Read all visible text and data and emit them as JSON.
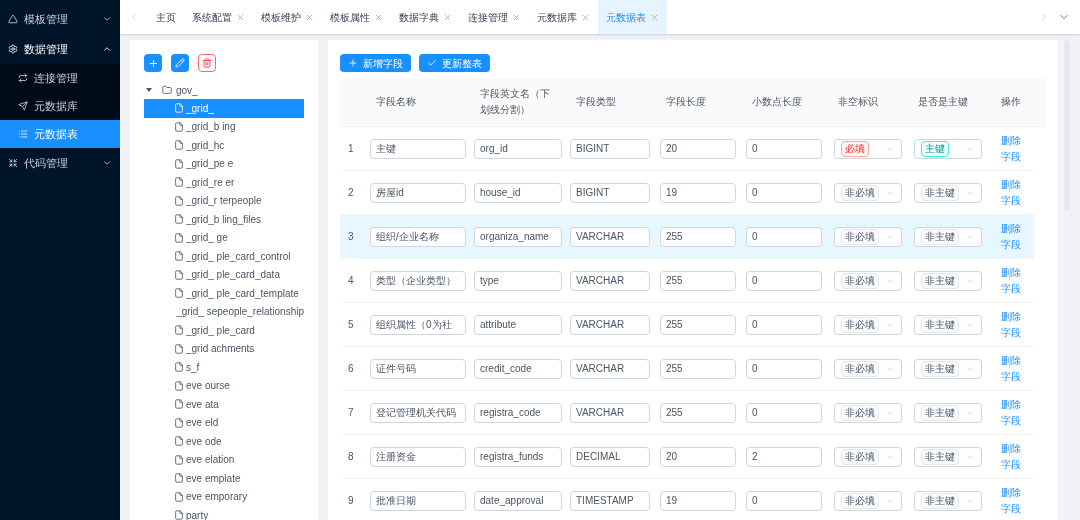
{
  "sidebar": {
    "items": [
      {
        "label": "模板管理",
        "expanded": false
      },
      {
        "label": "数据管理",
        "expanded": true,
        "children": [
          {
            "label": "连接管理",
            "selected": false
          },
          {
            "label": "元数据库",
            "selected": false
          },
          {
            "label": "元数据表",
            "selected": true
          }
        ]
      },
      {
        "label": "代码管理",
        "expanded": false
      }
    ]
  },
  "tabs": [
    {
      "label": "主页",
      "closable": false,
      "selected": false
    },
    {
      "label": "系统配置",
      "closable": true,
      "selected": false
    },
    {
      "label": "模板维护",
      "closable": true,
      "selected": false
    },
    {
      "label": "模板属性",
      "closable": true,
      "selected": false
    },
    {
      "label": "数据字典",
      "closable": true,
      "selected": false
    },
    {
      "label": "连接管理",
      "closable": true,
      "selected": false
    },
    {
      "label": "元数据库",
      "closable": true,
      "selected": false
    },
    {
      "label": "元数据表",
      "closable": true,
      "selected": true
    }
  ],
  "tree": {
    "root": {
      "label": "gov_",
      "expanded": true,
      "children": [
        {
          "label": "_grid_",
          "selected": true
        },
        {
          "label": "_grid_b ing",
          "selected": false
        },
        {
          "label": "_grid_hc",
          "selected": false
        },
        {
          "label": "_grid_pe e",
          "selected": false
        },
        {
          "label": "_grid_re er",
          "selected": false
        },
        {
          "label": "_grid_r terpeople",
          "selected": false
        },
        {
          "label": "_grid_b ling_files",
          "selected": false
        },
        {
          "label": "_grid_ ge",
          "selected": false
        },
        {
          "label": "_grid_ ple_card_control",
          "selected": false
        },
        {
          "label": "_grid_ ple_card_data",
          "selected": false
        },
        {
          "label": "_grid_ ple_card_template",
          "selected": false
        },
        {
          "label": "_grid_ sepeople_relationship",
          "selected": false
        },
        {
          "label": "_grid_ ple_card",
          "selected": false
        },
        {
          "label": "_grid achments",
          "selected": false
        },
        {
          "label": "s_f",
          "selected": false
        },
        {
          "label": "eve ourse",
          "selected": false
        },
        {
          "label": "eve ata",
          "selected": false
        },
        {
          "label": "eve eld",
          "selected": false
        },
        {
          "label": "eve ode",
          "selected": false
        },
        {
          "label": "eve elation",
          "selected": false
        },
        {
          "label": "eve emplate",
          "selected": false
        },
        {
          "label": "eve emporary",
          "selected": false
        },
        {
          "label": "party",
          "selected": false
        }
      ]
    }
  },
  "actions": [
    {
      "label": "新增字段",
      "kind": "add"
    },
    {
      "label": "更新整表",
      "kind": "check"
    }
  ],
  "table": {
    "columns": [
      "字段名称",
      "字段英文名（下划线分割）",
      "字段类型",
      "字段长度",
      "小数点长度",
      "非空标识",
      "是否是主键",
      "操作"
    ],
    "rows": [
      {
        "index": "1",
        "name": "主键",
        "english": "org_id",
        "type": "BIGINT",
        "length": "20",
        "decimal": "0",
        "not_null": {
          "label": "必填",
          "required": true
        },
        "primary_key": {
          "label": "主键",
          "primary": true
        },
        "action": "删除字段",
        "selected": false
      },
      {
        "index": "2",
        "name": "房屋id",
        "english": "house_id",
        "type": "BIGINT",
        "length": "19",
        "decimal": "0",
        "not_null": {
          "label": "非必填",
          "required": false
        },
        "primary_key": {
          "label": "非主键",
          "primary": false
        },
        "action": "删除字段",
        "selected": false
      },
      {
        "index": "3",
        "name": "组织/企业名称",
        "english": "organiza_name",
        "type": "VARCHAR",
        "length": "255",
        "decimal": "0",
        "not_null": {
          "label": "非必填",
          "required": false
        },
        "primary_key": {
          "label": "非主键",
          "primary": false
        },
        "action": "删除字段",
        "selected": true
      },
      {
        "index": "4",
        "name": "类型（企业类型）",
        "english": "type",
        "type": "VARCHAR",
        "length": "255",
        "decimal": "0",
        "not_null": {
          "label": "非必填",
          "required": false
        },
        "primary_key": {
          "label": "非主键",
          "primary": false
        },
        "action": "删除字段",
        "selected": false
      },
      {
        "index": "5",
        "name": "组织属性（0为社",
        "english": "attribute",
        "type": "VARCHAR",
        "length": "255",
        "decimal": "0",
        "not_null": {
          "label": "非必填",
          "required": false
        },
        "primary_key": {
          "label": "非主键",
          "primary": false
        },
        "action": "删除字段",
        "selected": false
      },
      {
        "index": "6",
        "name": "证件号码",
        "english": "credit_code",
        "type": "VARCHAR",
        "length": "255",
        "decimal": "0",
        "not_null": {
          "label": "非必填",
          "required": false
        },
        "primary_key": {
          "label": "非主键",
          "primary": false
        },
        "action": "删除字段",
        "selected": false
      },
      {
        "index": "7",
        "name": "登记管理机关代码",
        "english": "registra_code",
        "type": "VARCHAR",
        "length": "255",
        "decimal": "0",
        "not_null": {
          "label": "非必填",
          "required": false
        },
        "primary_key": {
          "label": "非主键",
          "primary": false
        },
        "action": "删除字段",
        "selected": false
      },
      {
        "index": "8",
        "name": "注册资金",
        "english": "registra_funds",
        "type": "DECIMAL",
        "length": "20",
        "decimal": "2",
        "not_null": {
          "label": "非必填",
          "required": false
        },
        "primary_key": {
          "label": "非主键",
          "primary": false
        },
        "action": "删除字段",
        "selected": false
      },
      {
        "index": "9",
        "name": "批准日期",
        "english": "date_approval",
        "type": "TIMESTAMP",
        "length": "19",
        "decimal": "0",
        "not_null": {
          "label": "非必填",
          "required": false
        },
        "primary_key": {
          "label": "非主键",
          "primary": false
        },
        "action": "删除字段",
        "selected": false
      }
    ]
  }
}
